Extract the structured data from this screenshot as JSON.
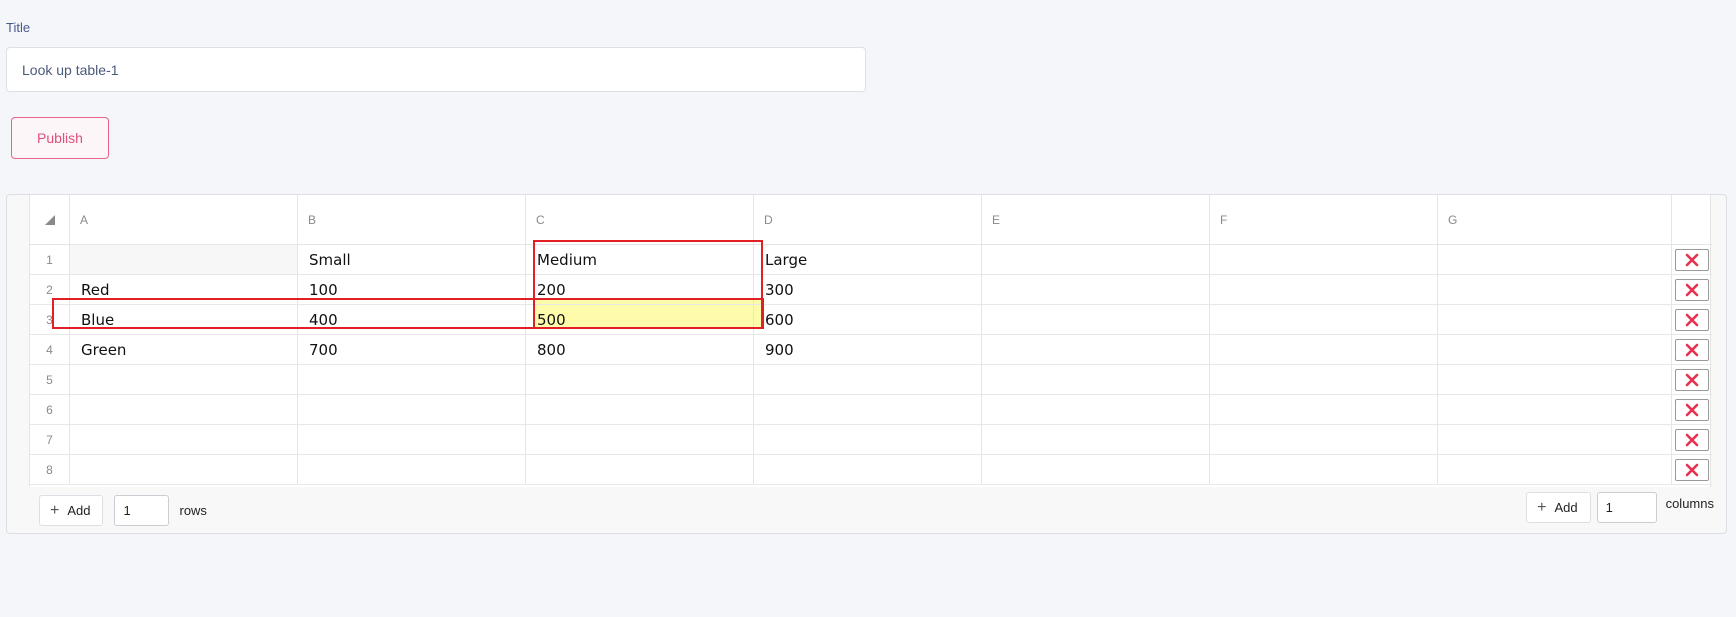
{
  "form": {
    "title_label": "Title",
    "title_value": "Look up table-1",
    "publish_label": "Publish"
  },
  "sheet": {
    "columns": [
      "A",
      "B",
      "C",
      "D",
      "E",
      "F",
      "G"
    ],
    "rows": [
      {
        "index": "1",
        "cells": [
          "",
          "Small",
          "Medium",
          "Large",
          "",
          "",
          ""
        ]
      },
      {
        "index": "2",
        "cells": [
          "Red",
          "100",
          "200",
          "300",
          "",
          "",
          ""
        ]
      },
      {
        "index": "3",
        "cells": [
          "Blue",
          "400",
          "500",
          "600",
          "",
          "",
          ""
        ]
      },
      {
        "index": "4",
        "cells": [
          "Green",
          "700",
          "800",
          "900",
          "",
          "",
          ""
        ]
      },
      {
        "index": "5",
        "cells": [
          "",
          "",
          "",
          "",
          "",
          "",
          ""
        ]
      },
      {
        "index": "6",
        "cells": [
          "",
          "",
          "",
          "",
          "",
          "",
          ""
        ]
      },
      {
        "index": "7",
        "cells": [
          "",
          "",
          "",
          "",
          "",
          "",
          ""
        ]
      },
      {
        "index": "8",
        "cells": [
          "",
          "",
          "",
          "",
          "",
          "",
          ""
        ]
      }
    ],
    "add_rows": {
      "button_label": "Add",
      "count": "1",
      "unit": "rows"
    },
    "add_columns": {
      "button_label": "Add",
      "count": "1",
      "unit": "columns"
    }
  },
  "colors": {
    "accent": "#e0507a",
    "delete_icon": "#e8304f",
    "annotation": "#e21f25",
    "highlight": "#fefcaa"
  },
  "icons": {
    "corner": "select-all-triangle-icon",
    "row_delete": "close-icon",
    "add": "plus-icon"
  }
}
